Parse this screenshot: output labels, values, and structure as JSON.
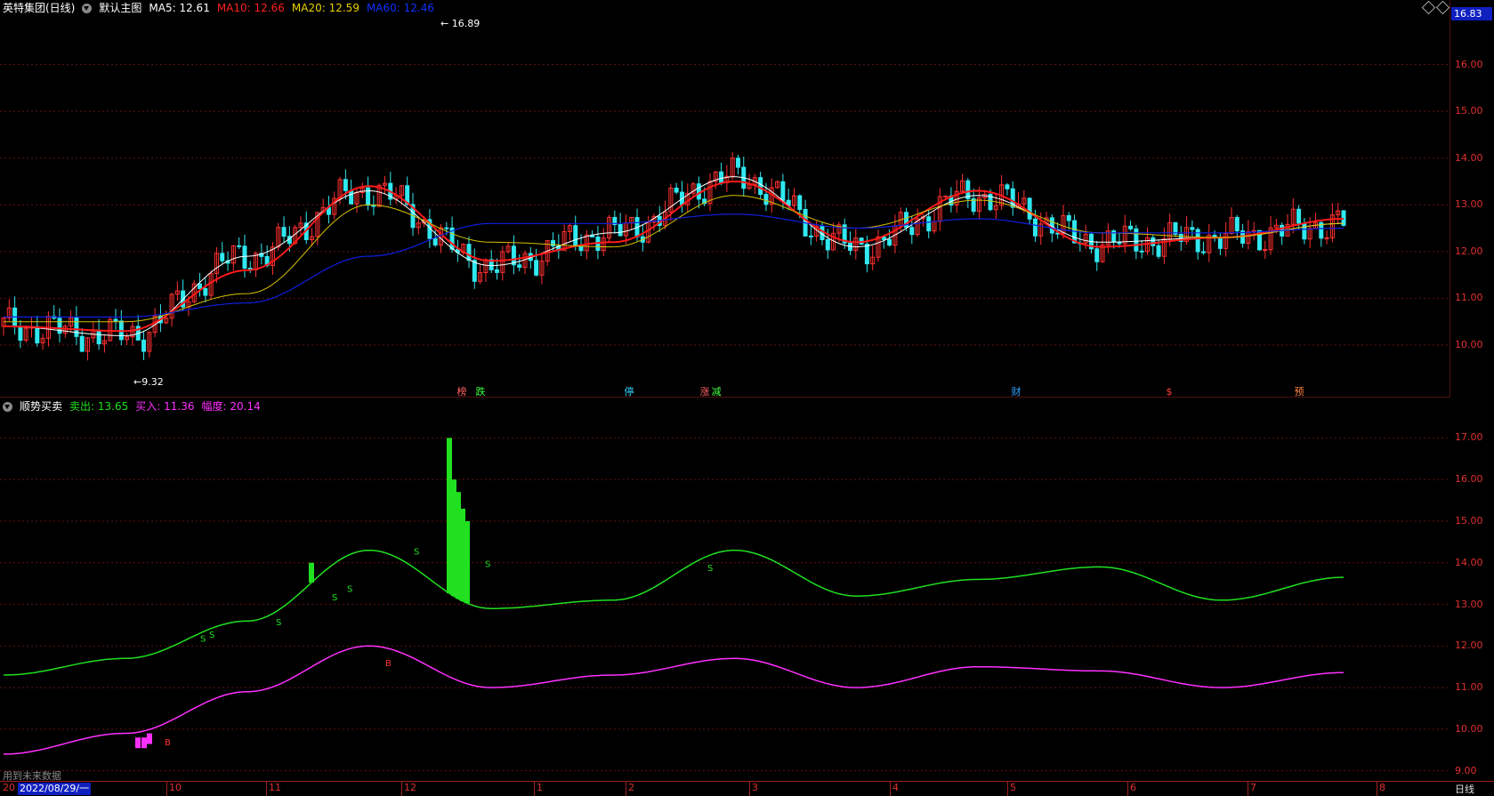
{
  "main_panel": {
    "title": "英特集团(日线)",
    "template": "默认主图",
    "ma5": {
      "label": "MA5:",
      "value": "12.61",
      "color": "#ffffff"
    },
    "ma10": {
      "label": "MA10:",
      "value": "12.66",
      "color": "#ff2020"
    },
    "ma20": {
      "label": "MA20:",
      "value": "12.59",
      "color": "#e8d000"
    },
    "ma60": {
      "label": "MA60:",
      "value": "12.46",
      "color": "#1030ff"
    },
    "current_price": "16.83",
    "max_label": "16.89",
    "min_label": "9.32",
    "y_ticks": [
      "16.00",
      "15.00",
      "14.00",
      "13.00",
      "12.00",
      "11.00",
      "10.00"
    ],
    "events": [
      {
        "text": "榜",
        "color": "#ff6060"
      },
      {
        "text": "跌",
        "color": "#40ff40"
      },
      {
        "text": "停",
        "color": "#30d0ff"
      },
      {
        "text": "涨",
        "color": "#ff6060"
      },
      {
        "text": "减",
        "color": "#40ff40"
      },
      {
        "text": "财",
        "color": "#30a0ff"
      },
      {
        "text": "$",
        "color": "#ff4040"
      },
      {
        "text": "预",
        "color": "#ff8040"
      }
    ]
  },
  "sub_panel": {
    "title": "顺势买卖",
    "sell": {
      "label": "卖出:",
      "value": "13.65",
      "color": "#20e020"
    },
    "buy": {
      "label": "买入:",
      "value": "11.36",
      "color": "#ff30ff"
    },
    "range": {
      "label": "幅度:",
      "value": "20.14",
      "color": "#ff30ff"
    },
    "y_ticks": [
      "17.00",
      "16.00",
      "15.00",
      "14.00",
      "13.00",
      "12.00",
      "11.00",
      "10.00",
      "9.00"
    ],
    "note": "用到未来数据",
    "signals": {
      "sell": "S",
      "buy": "B"
    }
  },
  "x_axis": {
    "cursor_date": "2022/08/29/一",
    "start_label": "20",
    "months": [
      "10",
      "11",
      "12",
      "1",
      "2",
      "3",
      "4",
      "5",
      "6",
      "7",
      "8"
    ],
    "period": "日线"
  },
  "chart_data": [
    {
      "type": "line",
      "title": "英特集团(日线)",
      "x": [
        "2022-08",
        "2022-10",
        "2022-11",
        "2022-12",
        "2023-01",
        "2023-02",
        "2023-03",
        "2023-04",
        "2023-05",
        "2023-06",
        "2023-07",
        "2023-08"
      ],
      "ylim": [
        9.2,
        17.0
      ],
      "series": [
        {
          "name": "MA5",
          "values": [
            10.4,
            10.2,
            11.9,
            13.3,
            11.7,
            12.4,
            13.6,
            12.1,
            13.2,
            12.2,
            12.3,
            12.6
          ]
        },
        {
          "name": "MA10",
          "values": [
            10.4,
            10.3,
            11.6,
            13.4,
            11.8,
            12.2,
            13.5,
            12.2,
            13.3,
            12.1,
            12.3,
            12.7
          ]
        },
        {
          "name": "MA20",
          "values": [
            10.5,
            10.5,
            11.1,
            13.0,
            12.2,
            12.1,
            13.2,
            12.5,
            13.1,
            12.4,
            12.3,
            12.6
          ]
        },
        {
          "name": "MA60",
          "values": [
            10.6,
            10.6,
            10.9,
            11.9,
            12.6,
            12.6,
            12.8,
            12.5,
            12.7,
            12.4,
            12.4,
            12.5
          ]
        }
      ]
    },
    {
      "type": "line",
      "title": "顺势买卖",
      "x": [
        "2022-08",
        "2022-10",
        "2022-11",
        "2022-12",
        "2023-01",
        "2023-02",
        "2023-03",
        "2023-04",
        "2023-05",
        "2023-06",
        "2023-07",
        "2023-08"
      ],
      "ylim": [
        8.8,
        17.5
      ],
      "series": [
        {
          "name": "卖出",
          "values": [
            11.3,
            11.7,
            12.6,
            14.3,
            12.9,
            13.1,
            14.3,
            13.2,
            13.6,
            13.9,
            13.1,
            13.65
          ]
        },
        {
          "name": "买入",
          "values": [
            9.4,
            9.9,
            10.9,
            12.0,
            11.0,
            11.3,
            11.7,
            11.0,
            11.5,
            11.4,
            11.0,
            11.36
          ]
        }
      ]
    }
  ]
}
